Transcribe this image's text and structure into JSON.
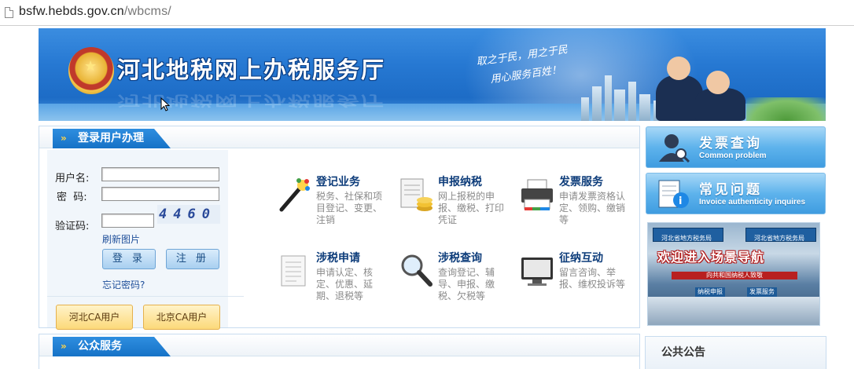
{
  "browser": {
    "url_host": "bsfw.hebds.gov.cn",
    "url_path": "/wbcms/"
  },
  "banner": {
    "title": "河北地税网上办税服务厅",
    "slogan_line1": "取之于民，用之于民",
    "slogan_line2": "用心服务百姓！"
  },
  "login": {
    "section_title": "登录用户办理",
    "username_label": "用户名:",
    "password_label": "密  码:",
    "captcha_label": "验证码:",
    "captcha_text": "4460",
    "refresh_label": "刷新图片",
    "login_button": "登 录",
    "register_button": "注 册",
    "forgot_link": "忘记密码?",
    "hebei_ca_button": "河北CA用户",
    "beijing_ca_button": "北京CA用户"
  },
  "services": [
    {
      "title": "登记业务",
      "desc": "税务、社保和项目登记、变更、注销",
      "icon": "magic-wand-icon"
    },
    {
      "title": "申报纳税",
      "desc": "网上报税的申报、缴税、打印凭证",
      "icon": "tax-form-coins-icon"
    },
    {
      "title": "发票服务",
      "desc": "申请发票资格认定、领购、缴销等",
      "icon": "printer-icon"
    },
    {
      "title": "涉税申请",
      "desc": "申请认定、核定、优惠、延期、退税等",
      "icon": "document-icon"
    },
    {
      "title": "涉税查询",
      "desc": "查询登记、辅导、申报、缴税、欠税等",
      "icon": "magnifier-icon"
    },
    {
      "title": "征纳互动",
      "desc": "留言咨询、举报、维权投诉等",
      "icon": "monitor-icon"
    }
  ],
  "sidebar": {
    "invoice_query_cn": "发票查询",
    "invoice_query_en": "Common problem",
    "faq_cn": "常见问题",
    "faq_en": "Invoice authenticity inquires",
    "scene_banner": "欢迎进入场景导航",
    "scene_board_left": "河北省地方税务局",
    "scene_board_right": "河北省地方税务局",
    "scene_slogan": "向共和国纳税人致敬",
    "scene_signs": [
      "纳税申报",
      "发票服务"
    ]
  },
  "public_service": {
    "section_title": "公众服务"
  },
  "notice": {
    "title": "公共公告"
  },
  "colors": {
    "brand_blue": "#1672c7",
    "link_blue": "#1f4f9a",
    "service_title": "#0d3c7a"
  }
}
